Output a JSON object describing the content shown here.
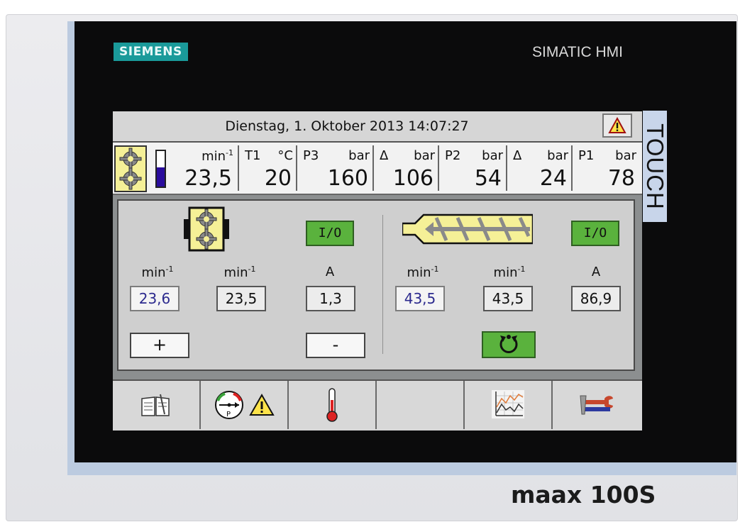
{
  "branding": {
    "manufacturer": "SIEMENS",
    "product_line": "SIMATIC HMI",
    "side_label": "TOUCH",
    "model": "maax 100S"
  },
  "hmi": {
    "datetime": "Dienstag, 1. Oktober 2013 14:07:27",
    "gauges": {
      "speed": {
        "unit": "min",
        "exp": "-1",
        "value": "23,5",
        "level": 0.55
      },
      "t1": {
        "label": "T1",
        "unit": "°C",
        "value": "20"
      },
      "p3": {
        "label": "P3",
        "unit": "bar",
        "value": "160"
      },
      "delta1": {
        "label": "Δ",
        "unit": "bar",
        "value": "106"
      },
      "p2": {
        "label": "P2",
        "unit": "bar",
        "value": "54"
      },
      "delta2": {
        "label": "Δ",
        "unit": "bar",
        "value": "24"
      },
      "p1": {
        "label": "P1",
        "unit": "bar",
        "value": "78"
      }
    },
    "left_panel": {
      "io_label": "I/O",
      "col1": {
        "unit": "min",
        "exp": "-1",
        "value": "23,6"
      },
      "col2": {
        "unit": "min",
        "exp": "-1",
        "value": "23,5"
      },
      "col3": {
        "unit": "A",
        "value": "1,3"
      },
      "plus_label": "+",
      "minus_label": "-"
    },
    "right_panel": {
      "io_label": "I/O",
      "col1": {
        "unit": "min",
        "exp": "-1",
        "value": "43,5"
      },
      "col2": {
        "unit": "min",
        "exp": "-1",
        "value": "43,5"
      },
      "col3": {
        "unit": "A",
        "value": "86,9"
      }
    },
    "pressure_icon_letter": "P"
  },
  "colors": {
    "accent_green": "#5ab23d",
    "gear_yellow": "#f5f097",
    "setpoint_blue": "#2c2a8e",
    "siemens_teal": "#1a9a9a"
  }
}
